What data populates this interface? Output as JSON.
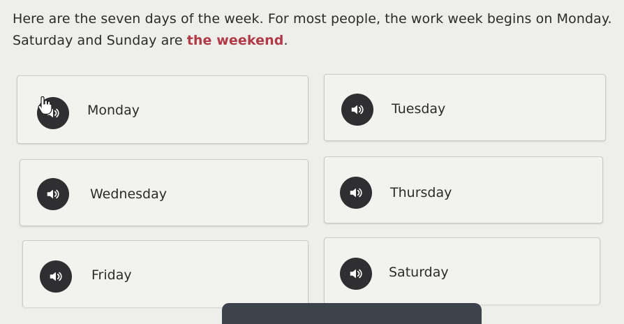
{
  "intro": {
    "text_before": "Here are the seven days of the week. For most people, the work week begins on Monday. Saturday and Sunday are ",
    "highlight": "the weekend",
    "text_after": "."
  },
  "colors": {
    "accent": "#b03a48",
    "audio_button": "#2f2f31",
    "card_border": "#c9cac6",
    "bottom_bar": "#3c434d"
  },
  "days": [
    {
      "label": "Monday",
      "icon": "speaker-icon"
    },
    {
      "label": "Tuesday",
      "icon": "speaker-icon"
    },
    {
      "label": "Wednesday",
      "icon": "speaker-icon"
    },
    {
      "label": "Thursday",
      "icon": "speaker-icon"
    },
    {
      "label": "Friday",
      "icon": "speaker-icon"
    },
    {
      "label": "Saturday",
      "icon": "speaker-icon"
    }
  ]
}
